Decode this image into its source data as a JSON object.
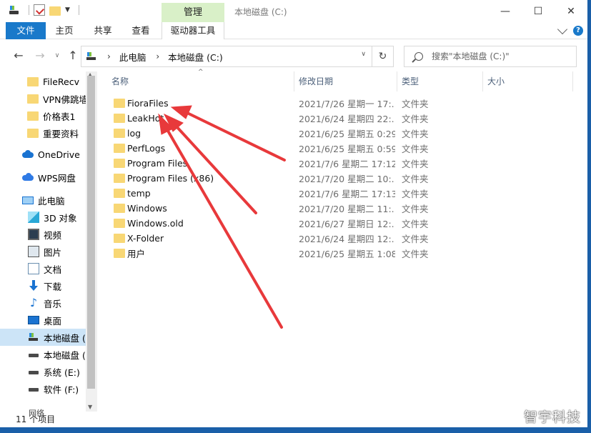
{
  "titlebar": {
    "manage_tab": "管理",
    "window_title": "本地磁盘 (C:)",
    "minimize": "—",
    "maximize": "☐",
    "close": "✕"
  },
  "ribbon": {
    "file": "文件",
    "home": "主页",
    "share": "共享",
    "view": "查看",
    "drive_tools": "驱动器工具",
    "help": "?"
  },
  "address": {
    "crumbs": [
      "此电脑",
      "本地磁盘 (C:)"
    ],
    "separator": "›",
    "search_placeholder": "搜索\"本地磁盘 (C:)\""
  },
  "sidebar": {
    "items": [
      {
        "label": "FileRecv",
        "icon": "folder-icon"
      },
      {
        "label": "VPN佛跳墙",
        "icon": "folder-icon"
      },
      {
        "label": "价格表1",
        "icon": "folder-icon"
      },
      {
        "label": "重要资料",
        "icon": "folder-icon"
      },
      {
        "label": "OneDrive",
        "icon": "onedrive-icon"
      },
      {
        "label": "WPS网盘",
        "icon": "wps-cloud-icon"
      },
      {
        "label": "此电脑",
        "icon": "computer-icon"
      },
      {
        "label": "3D 对象",
        "icon": "3d-objects-icon"
      },
      {
        "label": "视频",
        "icon": "video-icon"
      },
      {
        "label": "图片",
        "icon": "pictures-icon"
      },
      {
        "label": "文档",
        "icon": "documents-icon"
      },
      {
        "label": "下载",
        "icon": "download-icon"
      },
      {
        "label": "音乐",
        "icon": "music-icon"
      },
      {
        "label": "桌面",
        "icon": "desktop-icon"
      },
      {
        "label": "本地磁盘 (C:)",
        "icon": "system-drive-icon"
      },
      {
        "label": "本地磁盘 (D:)",
        "icon": "drive-icon"
      },
      {
        "label": "系统 (E:)",
        "icon": "drive-icon"
      },
      {
        "label": "软件 (F:)",
        "icon": "drive-icon"
      }
    ]
  },
  "columns": {
    "name": "名称",
    "date": "修改日期",
    "type": "类型",
    "size": "大小"
  },
  "files": [
    {
      "name": "FioraFiles",
      "date": "2021/7/26 星期一 17:...",
      "type": "文件夹"
    },
    {
      "name": "LeakHot",
      "date": "2021/6/24 星期四 22:...",
      "type": "文件夹"
    },
    {
      "name": "log",
      "date": "2021/6/25 星期五 0:29",
      "type": "文件夹"
    },
    {
      "name": "PerfLogs",
      "date": "2021/6/25 星期五 0:59",
      "type": "文件夹"
    },
    {
      "name": "Program Files",
      "date": "2021/7/6 星期二 17:12",
      "type": "文件夹"
    },
    {
      "name": "Program Files (x86)",
      "date": "2021/7/20 星期二 10:...",
      "type": "文件夹"
    },
    {
      "name": "temp",
      "date": "2021/7/6 星期二 17:13",
      "type": "文件夹"
    },
    {
      "name": "Windows",
      "date": "2021/7/20 星期二 11:...",
      "type": "文件夹"
    },
    {
      "name": "Windows.old",
      "date": "2021/6/27 星期日 12:...",
      "type": "文件夹"
    },
    {
      "name": "X-Folder",
      "date": "2021/6/24 星期四 12:...",
      "type": "文件夹"
    },
    {
      "name": "用户",
      "date": "2021/6/25 星期五 1:08",
      "type": "文件夹"
    }
  ],
  "status": {
    "count": "11 个项目",
    "network": "网络"
  },
  "watermark": "智宇科技",
  "colors": {
    "accent": "#1979ca",
    "manage_tab_bg": "#d9f0c8",
    "selected_bg": "#cce4f7",
    "folder": "#f8d775",
    "arrow": "#e8393b"
  }
}
